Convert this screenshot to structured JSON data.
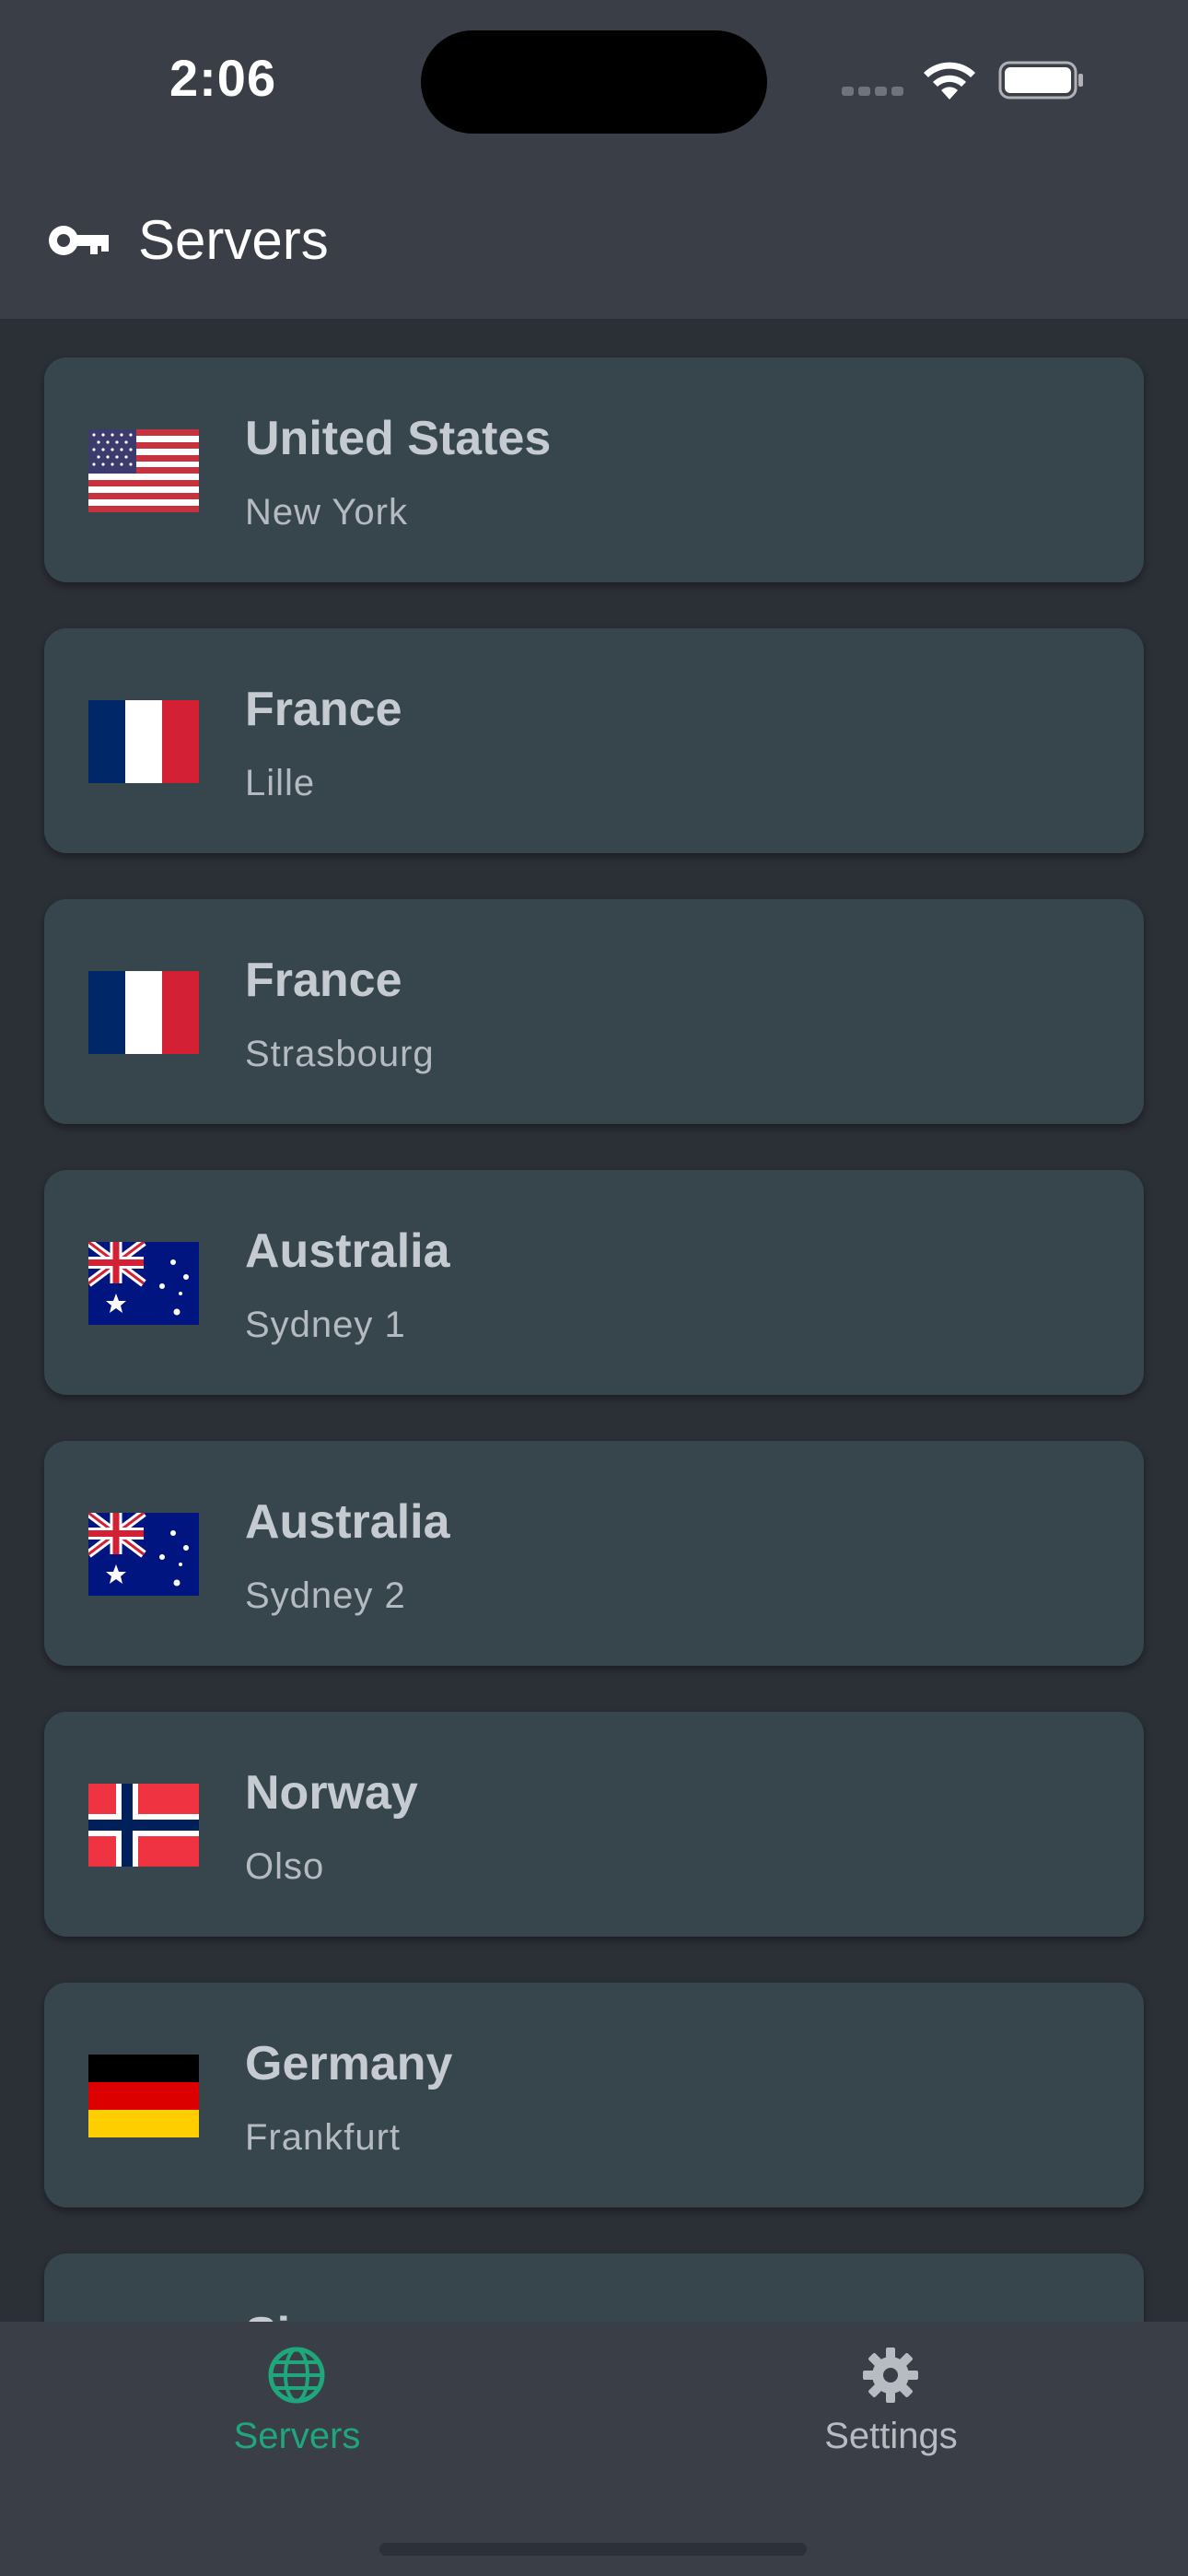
{
  "status_bar": {
    "time": "2:06"
  },
  "app_bar": {
    "icon": "key-icon",
    "title": "Servers"
  },
  "servers": [
    {
      "country": "United States",
      "city": "New York",
      "flag": "us-flag-icon"
    },
    {
      "country": "France",
      "city": "Lille",
      "flag": "france-flag-icon"
    },
    {
      "country": "France",
      "city": "Strasbourg",
      "flag": "france-flag-icon"
    },
    {
      "country": "Australia",
      "city": "Sydney 1",
      "flag": "australia-flag-icon"
    },
    {
      "country": "Australia",
      "city": "Sydney 2",
      "flag": "australia-flag-icon"
    },
    {
      "country": "Norway",
      "city": "Olso",
      "flag": "norway-flag-icon"
    },
    {
      "country": "Germany",
      "city": "Frankfurt",
      "flag": "germany-flag-icon"
    },
    {
      "country": "Singapore",
      "city": "",
      "flag": "singapore-flag-icon"
    }
  ],
  "tab_bar": {
    "servers_label": "Servers",
    "settings_label": "Settings",
    "active_tab": "Servers",
    "active_color": "#1fa67a",
    "inactive_color": "#b7bcc2"
  }
}
